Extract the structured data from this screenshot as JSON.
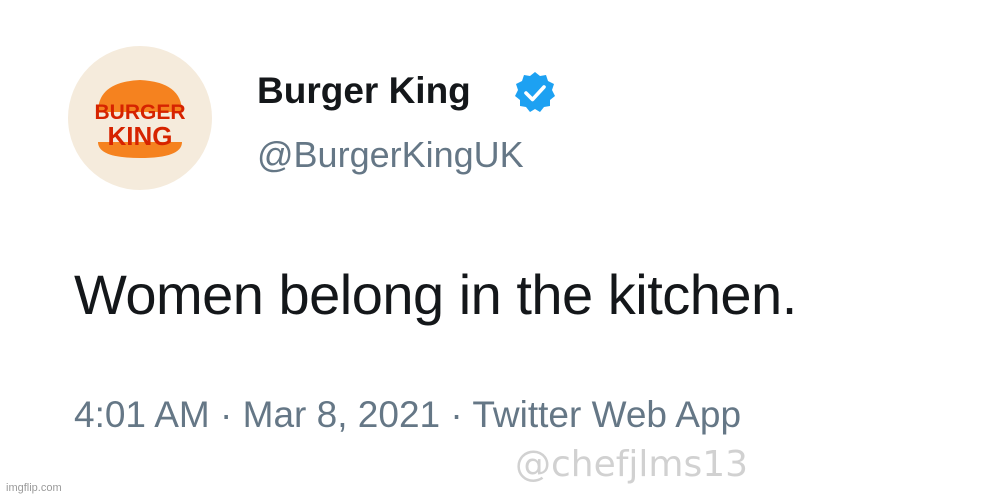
{
  "account": {
    "display_name": "Burger King",
    "handle": "@BurgerKingUK",
    "verified": true,
    "avatar_logo_line1": "BURGER",
    "avatar_logo_line2": "KING"
  },
  "tweet": {
    "text": "Women belong in the kitchen.",
    "time": "4:01 AM",
    "separator": "·",
    "date": "Mar 8, 2021",
    "source": "Twitter Web App"
  },
  "overlay": {
    "credit": "imgflip.com",
    "watermark": "@chefjlms13"
  },
  "colors": {
    "primary_text": "#14171a",
    "secondary_text": "#657786",
    "verified_blue": "#1da1f2",
    "logo_red": "#d62300",
    "logo_orange": "#f5821f",
    "avatar_bg": "#f5ebdc"
  },
  "icons": {
    "verified": "verified-badge-icon",
    "avatar": "burger-king-logo"
  }
}
